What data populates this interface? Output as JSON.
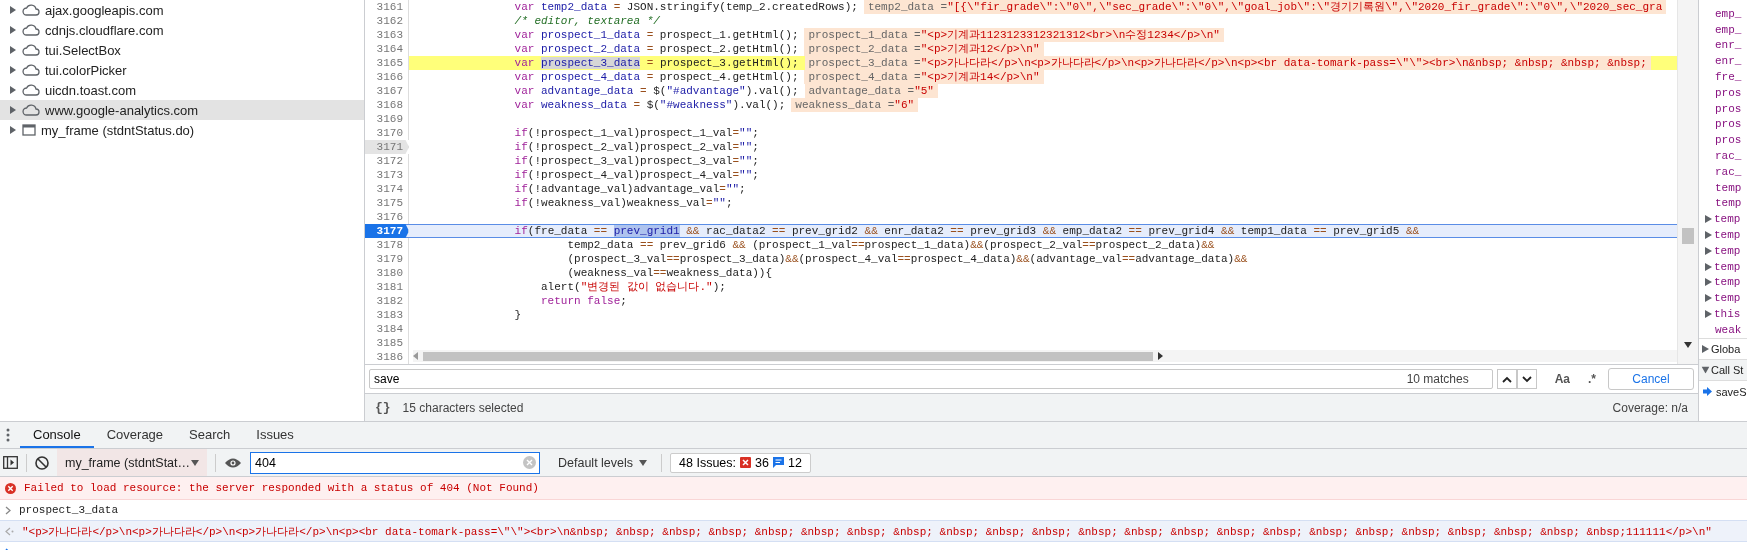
{
  "sidebar": {
    "items": [
      {
        "label": "ajax.googleapis.com",
        "kind": "domain",
        "expanded": false,
        "selected": false
      },
      {
        "label": "cdnjs.cloudflare.com",
        "kind": "domain",
        "expanded": false,
        "selected": false
      },
      {
        "label": "tui.SelectBox",
        "kind": "domain",
        "expanded": false,
        "selected": false
      },
      {
        "label": "tui.colorPicker",
        "kind": "domain",
        "expanded": false,
        "selected": false
      },
      {
        "label": "uicdn.toast.com",
        "kind": "domain",
        "expanded": false,
        "selected": false
      },
      {
        "label": "www.google-analytics.com",
        "kind": "domain",
        "expanded": false,
        "selected": true
      },
      {
        "label": "my_frame (stdntStatus.do)",
        "kind": "frame",
        "expanded": false,
        "selected": false
      }
    ]
  },
  "editor": {
    "lines": [
      {
        "number": "3161",
        "kind": "plain",
        "tokens": [
          {
            "kind": "kw",
            "text": "                var"
          },
          {
            "kind": "def",
            "text": " temp2_data"
          },
          {
            "kind": "op",
            "text": " = "
          },
          {
            "kind": "pl",
            "text": "JSON.stringify(temp_2.createdRows);"
          }
        ],
        "inline_value": {
          "name": "temp2_data =",
          "value": "\"[{\\\"fir_grade\\\":\\\"0\\\",\\\"sec_grade\\\":\\\"0\\\",\\\"goal_job\\\":\\\"경기기록원\\\",\\\"2020_fir_grade\\\":\\\"0\\\",\\\"2020_sec_gra"
        }
      },
      {
        "number": "3162",
        "kind": "plain",
        "tokens": [
          {
            "kind": "com",
            "text": "                /* editor, textarea */"
          }
        ]
      },
      {
        "number": "3163",
        "kind": "plain",
        "tokens": [
          {
            "kind": "kw",
            "text": "                var"
          },
          {
            "kind": "def",
            "text": " prospect_1_data"
          },
          {
            "kind": "op",
            "text": " = "
          },
          {
            "kind": "pl",
            "text": "prospect_1.getHtml();"
          }
        ],
        "inline_value": {
          "name": "prospect_1_data =",
          "value": "\"<p>기계과1123123312321312<br>\\n수정1234</p>\\n\""
        }
      },
      {
        "number": "3164",
        "kind": "plain",
        "tokens": [
          {
            "kind": "kw",
            "text": "                var"
          },
          {
            "kind": "def",
            "text": " prospect_2_data"
          },
          {
            "kind": "op",
            "text": " = "
          },
          {
            "kind": "pl",
            "text": "prospect_2.getHtml();"
          }
        ],
        "inline_value": {
          "name": "prospect_2_data =",
          "value": "\"<p>기계과12</p>\\n\""
        }
      },
      {
        "number": "3165",
        "kind": "search-hit",
        "tokens": [
          {
            "kind": "kw",
            "text": "                var "
          },
          {
            "kind": "sel",
            "text": "prospect_3_data"
          },
          {
            "kind": "op",
            "text": " = "
          },
          {
            "kind": "pl",
            "text": "prospect_3.getHtml();"
          }
        ],
        "inline_value": {
          "name": "prospect_3_data =",
          "value": "\"<p>가나다라</p>\\n<p>가나다라</p>\\n<p>가나다라</p>\\n<p><br data-tomark-pass=\\\"\\\"><br>\\n&nbsp; &nbsp; &nbsp; &nbsp;"
        }
      },
      {
        "number": "3166",
        "kind": "plain",
        "tokens": [
          {
            "kind": "kw",
            "text": "                var"
          },
          {
            "kind": "def",
            "text": " prospect_4_data"
          },
          {
            "kind": "op",
            "text": " = "
          },
          {
            "kind": "pl",
            "text": "prospect_4.getHtml();"
          }
        ],
        "inline_value": {
          "name": "prospect_4_data =",
          "value": "\"<p>기계과14</p>\\n\""
        }
      },
      {
        "number": "3167",
        "kind": "plain",
        "tokens": [
          {
            "kind": "kw",
            "text": "                var"
          },
          {
            "kind": "def",
            "text": " advantage_data"
          },
          {
            "kind": "op",
            "text": " = "
          },
          {
            "kind": "pl",
            "text": "$("
          },
          {
            "kind": "def",
            "text": "\"#advantage\""
          },
          {
            "kind": "pl",
            "text": ").val();"
          }
        ],
        "inline_value": {
          "name": "advantage_data =",
          "value": "\"5\""
        }
      },
      {
        "number": "3168",
        "kind": "plain",
        "tokens": [
          {
            "kind": "kw",
            "text": "                var"
          },
          {
            "kind": "def",
            "text": " weakness_data"
          },
          {
            "kind": "op",
            "text": " = "
          },
          {
            "kind": "pl",
            "text": "$("
          },
          {
            "kind": "def",
            "text": "\"#weakness\""
          },
          {
            "kind": "pl",
            "text": ").val();"
          }
        ],
        "inline_value": {
          "name": "weakness_data =",
          "value": "\"6\""
        }
      },
      {
        "number": "3169",
        "kind": "plain"
      },
      {
        "number": "3170",
        "kind": "plain",
        "tokens": [
          {
            "kind": "kw",
            "text": "                if"
          },
          {
            "kind": "pl",
            "text": "(!prospect_1_val)prospect_1_val"
          },
          {
            "kind": "op",
            "text": "="
          },
          {
            "kind": "def",
            "text": "\"\""
          },
          {
            "kind": "pl",
            "text": ";"
          }
        ]
      },
      {
        "number": "3171",
        "kind": "marked",
        "tokens": [
          {
            "kind": "kw",
            "text": "                if"
          },
          {
            "kind": "pl",
            "text": "(!prospect_2_val)prospect_2_val"
          },
          {
            "kind": "op",
            "text": "="
          },
          {
            "kind": "def",
            "text": "\"\""
          },
          {
            "kind": "pl",
            "text": ";"
          }
        ]
      },
      {
        "number": "3172",
        "kind": "plain",
        "tokens": [
          {
            "kind": "kw",
            "text": "                if"
          },
          {
            "kind": "pl",
            "text": "(!prospect_3_val)prospect_3_val"
          },
          {
            "kind": "op",
            "text": "="
          },
          {
            "kind": "def",
            "text": "\"\""
          },
          {
            "kind": "pl",
            "text": ";"
          }
        ]
      },
      {
        "number": "3173",
        "kind": "plain",
        "tokens": [
          {
            "kind": "kw",
            "text": "                if"
          },
          {
            "kind": "pl",
            "text": "(!prospect_4_val)prospect_4_val"
          },
          {
            "kind": "op",
            "text": "="
          },
          {
            "kind": "def",
            "text": "\"\""
          },
          {
            "kind": "pl",
            "text": ";"
          }
        ]
      },
      {
        "number": "3174",
        "kind": "plain",
        "tokens": [
          {
            "kind": "kw",
            "text": "                if"
          },
          {
            "kind": "pl",
            "text": "(!advantage_val)advantage_val"
          },
          {
            "kind": "op",
            "text": "="
          },
          {
            "kind": "def",
            "text": "\"\""
          },
          {
            "kind": "pl",
            "text": ";"
          }
        ]
      },
      {
        "number": "3175",
        "kind": "plain",
        "tokens": [
          {
            "kind": "kw",
            "text": "                if"
          },
          {
            "kind": "pl",
            "text": "(!weakness_val)weakness_val"
          },
          {
            "kind": "op",
            "text": "="
          },
          {
            "kind": "def",
            "text": "\"\""
          },
          {
            "kind": "pl",
            "text": ";"
          }
        ]
      },
      {
        "number": "3176",
        "kind": "plain"
      },
      {
        "number": "3177",
        "kind": "paused",
        "tokens": [
          {
            "kind": "kw",
            "text": "                if"
          },
          {
            "kind": "pl",
            "text": "(fre_data "
          },
          {
            "kind": "op",
            "text": "== "
          },
          {
            "kind": "sel",
            "text": "prev_grid1"
          },
          {
            "kind": "op",
            "text": " &&"
          },
          {
            "kind": "pl",
            "text": " rac_data2 "
          },
          {
            "kind": "op",
            "text": "=="
          },
          {
            "kind": "pl",
            "text": " prev_grid2 "
          },
          {
            "kind": "op",
            "text": "&&"
          },
          {
            "kind": "pl",
            "text": " enr_data2 "
          },
          {
            "kind": "op",
            "text": "=="
          },
          {
            "kind": "pl",
            "text": " prev_grid3 "
          },
          {
            "kind": "op",
            "text": "&&"
          },
          {
            "kind": "pl",
            "text": " emp_data2 "
          },
          {
            "kind": "op",
            "text": "=="
          },
          {
            "kind": "pl",
            "text": " prev_grid4 "
          },
          {
            "kind": "op",
            "text": "&&"
          },
          {
            "kind": "pl",
            "text": " temp1_data "
          },
          {
            "kind": "op",
            "text": "=="
          },
          {
            "kind": "pl",
            "text": " prev_grid5 "
          },
          {
            "kind": "op",
            "text": "&&"
          }
        ]
      },
      {
        "number": "3178",
        "kind": "plain",
        "tokens": [
          {
            "kind": "pl",
            "text": "                        temp2_data "
          },
          {
            "kind": "op",
            "text": "=="
          },
          {
            "kind": "pl",
            "text": " prev_grid6 "
          },
          {
            "kind": "op",
            "text": "&&"
          },
          {
            "kind": "pl",
            "text": " (prospect_1_val"
          },
          {
            "kind": "op",
            "text": "=="
          },
          {
            "kind": "pl",
            "text": "prospect_1_data)"
          },
          {
            "kind": "op",
            "text": "&&"
          },
          {
            "kind": "pl",
            "text": "(prospect_2_val"
          },
          {
            "kind": "op",
            "text": "=="
          },
          {
            "kind": "pl",
            "text": "prospect_2_data)"
          },
          {
            "kind": "op",
            "text": "&&"
          }
        ]
      },
      {
        "number": "3179",
        "kind": "plain",
        "tokens": [
          {
            "kind": "pl",
            "text": "                        (prospect_3_val"
          },
          {
            "kind": "op",
            "text": "=="
          },
          {
            "kind": "pl",
            "text": "prospect_3_data)"
          },
          {
            "kind": "op",
            "text": "&&"
          },
          {
            "kind": "pl",
            "text": "(prospect_4_val"
          },
          {
            "kind": "op",
            "text": "=="
          },
          {
            "kind": "pl",
            "text": "prospect_4_data)"
          },
          {
            "kind": "op",
            "text": "&&"
          },
          {
            "kind": "pl",
            "text": "(advantage_val"
          },
          {
            "kind": "op",
            "text": "=="
          },
          {
            "kind": "pl",
            "text": "advantage_data)"
          },
          {
            "kind": "op",
            "text": "&&"
          }
        ]
      },
      {
        "number": "3180",
        "kind": "plain",
        "tokens": [
          {
            "kind": "pl",
            "text": "                        (weakness_val"
          },
          {
            "kind": "op",
            "text": "=="
          },
          {
            "kind": "pl",
            "text": "weakness_data)){"
          }
        ]
      },
      {
        "number": "3181",
        "kind": "plain",
        "tokens": [
          {
            "kind": "pl",
            "text": "                    alert("
          },
          {
            "kind": "str",
            "text": "\"변경된 값이 없습니다.\""
          },
          {
            "kind": "pl",
            "text": ");"
          }
        ]
      },
      {
        "number": "3182",
        "kind": "plain",
        "tokens": [
          {
            "kind": "kw",
            "text": "                    return"
          },
          {
            "kind": "kw",
            "text": " false"
          },
          {
            "kind": "pl",
            "text": ";"
          }
        ]
      },
      {
        "number": "3183",
        "kind": "plain",
        "tokens": [
          {
            "kind": "pl",
            "text": "                }"
          }
        ]
      },
      {
        "number": "3184",
        "kind": "plain"
      },
      {
        "number": "3185",
        "kind": "plain"
      },
      {
        "number": "3186",
        "kind": "plain"
      }
    ]
  },
  "search": {
    "value": "save",
    "match_count": "10 matches",
    "match_case": "Aa",
    "regex": ".*",
    "cancel": "Cancel"
  },
  "status_bar": {
    "pretty_print": "{}",
    "selection": "15 characters selected",
    "coverage": "Coverage: n/a"
  },
  "scope": {
    "items": [
      {
        "name": "emp_",
        "kind": "leaf"
      },
      {
        "name": "emp_",
        "kind": "leaf"
      },
      {
        "name": "enr_",
        "kind": "leaf"
      },
      {
        "name": "enr_",
        "kind": "leaf"
      },
      {
        "name": "fre_",
        "kind": "leaf"
      },
      {
        "name": "pros",
        "kind": "leaf"
      },
      {
        "name": "pros",
        "kind": "leaf"
      },
      {
        "name": "pros",
        "kind": "leaf"
      },
      {
        "name": "pros",
        "kind": "leaf"
      },
      {
        "name": "rac_",
        "kind": "leaf"
      },
      {
        "name": "rac_",
        "kind": "leaf"
      },
      {
        "name": "temp",
        "kind": "leaf"
      },
      {
        "name": "temp",
        "kind": "leaf"
      },
      {
        "name": "temp",
        "kind": "node",
        "expanded": false
      },
      {
        "name": "temp",
        "kind": "node",
        "expanded": false
      },
      {
        "name": "temp",
        "kind": "node",
        "expanded": false
      },
      {
        "name": "temp",
        "kind": "node",
        "expanded": false
      },
      {
        "name": "temp",
        "kind": "node",
        "expanded": false
      },
      {
        "name": "temp",
        "kind": "node",
        "expanded": false
      },
      {
        "name": "this",
        "kind": "node",
        "expanded": false
      },
      {
        "name": "weak",
        "kind": "leaf"
      }
    ],
    "global": {
      "label": "Globa",
      "expanded": false
    },
    "call_stack": {
      "label": "Call St",
      "expanded": true,
      "frames": [
        {
          "label": "saveS",
          "selected": true
        }
      ]
    }
  },
  "drawer": {
    "tabs": [
      {
        "label": "Console",
        "selected": true
      },
      {
        "label": "Coverage",
        "selected": false
      },
      {
        "label": "Search",
        "selected": false
      },
      {
        "label": "Issues",
        "selected": false
      }
    ],
    "context": "my_frame (stdntStat…",
    "filter": "404",
    "levels": "Default levels",
    "issues": {
      "label": "48 Issues:",
      "errors": "36",
      "infos": "12"
    },
    "messages": [
      {
        "kind": "error",
        "text": "Failed to load resource: the server responded with a status of 404 (Not Found)"
      },
      {
        "kind": "input",
        "text": "prospect_3_data"
      },
      {
        "kind": "result",
        "text": "\"<p>가나다라</p>\\n<p>가나다라</p>\\n<p>가나다라</p>\\n<p><br data-tomark-pass=\\\"\\\"><br>\\n&nbsp; &nbsp; &nbsp; &nbsp; &nbsp; &nbsp; &nbsp; &nbsp; &nbsp; &nbsp; &nbsp; &nbsp; &nbsp; &nbsp; &nbsp; &nbsp; &nbsp; &nbsp; &nbsp; &nbsp; &nbsp; &nbsp; &nbsp;111111</p>\\n\""
      },
      {
        "kind": "prompt"
      }
    ]
  }
}
